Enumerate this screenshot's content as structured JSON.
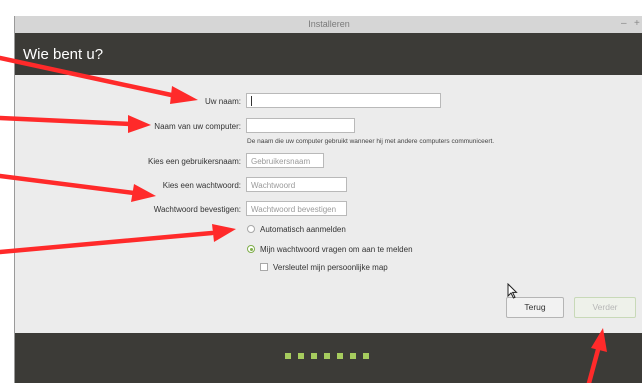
{
  "window": {
    "title": "Installeren",
    "minimize_glyph": "–",
    "close_glyph": "+"
  },
  "header": {
    "title": "Wie bent u?"
  },
  "form": {
    "name_label": "Uw naam:",
    "name_value": "",
    "computer_label": "Naam van uw computer:",
    "computer_value": "",
    "computer_hint": "De naam die uw computer gebruikt wanneer hij met andere computers communiceert.",
    "username_label": "Kies een gebruikersnaam:",
    "username_placeholder": "Gebruikersnaam",
    "password_label": "Kies een wachtwoord:",
    "password_placeholder": "Wachtwoord",
    "confirm_label": "Wachtwoord bevestigen:",
    "confirm_placeholder": "Wachtwoord bevestigen",
    "login_options": [
      {
        "label": "Automatisch aanmelden",
        "selected": false
      },
      {
        "label": "Mijn wachtwoord vragen om aan te melden",
        "selected": true
      }
    ],
    "encrypt_label": "Versleutel mijn persoonlijke map",
    "encrypt_checked": false
  },
  "buttons": {
    "back_label": "Terug",
    "next_label": "Verder"
  },
  "progress": {
    "steps": 7
  },
  "colors": {
    "header_bg": "#3c3b37",
    "accent": "#a6cc5e",
    "annotation_arrow": "#ff2a2a"
  }
}
